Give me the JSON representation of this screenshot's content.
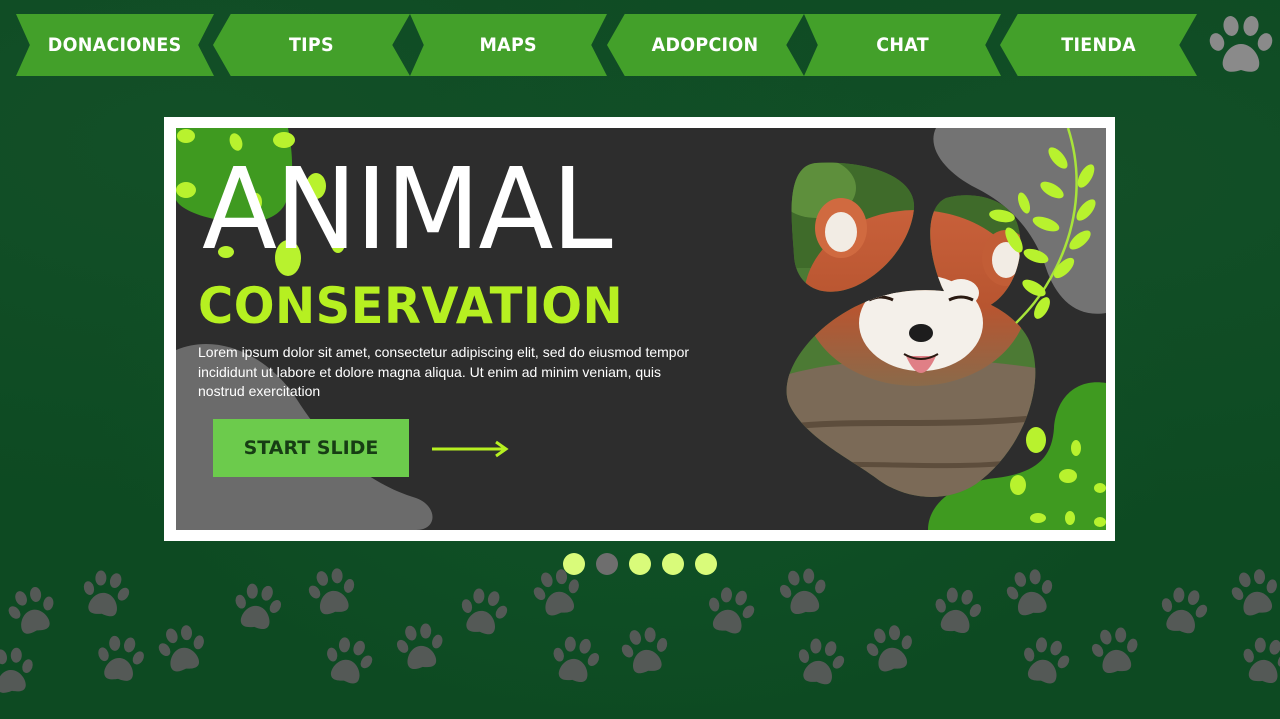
{
  "nav": {
    "items": [
      {
        "label": "DONACIONES"
      },
      {
        "label": "TIPS"
      },
      {
        "label": "MAPS"
      },
      {
        "label": "ADOPCION"
      },
      {
        "label": "CHAT"
      },
      {
        "label": "TIENDA"
      }
    ],
    "logo_icon": "paw-icon"
  },
  "banner": {
    "title": "ANIMAL",
    "subtitle": "CONSERVATION",
    "description": "Lorem ipsum dolor sit amet, consectetur adipiscing elit, sed do eiusmod tempor incididunt ut labore et dolore magna aliqua. Ut enim ad minim veniam, quis nostrud exercitation",
    "button_label": "START SLIDE",
    "arrow_icon": "arrow-right-icon",
    "image": "red-panda-photo"
  },
  "carousel": {
    "slide_count": 5,
    "active_index": 1
  },
  "colors": {
    "background": "#0d4a22",
    "nav_green": "#43a02a",
    "lime_accent": "#b6f021",
    "button_green": "#6ccb4c",
    "banner_dark": "#2d2d2d",
    "dot_inactive": "#d9fb7a",
    "dot_active": "#6e6e6e",
    "paw_gray": "#5a5a5a"
  }
}
